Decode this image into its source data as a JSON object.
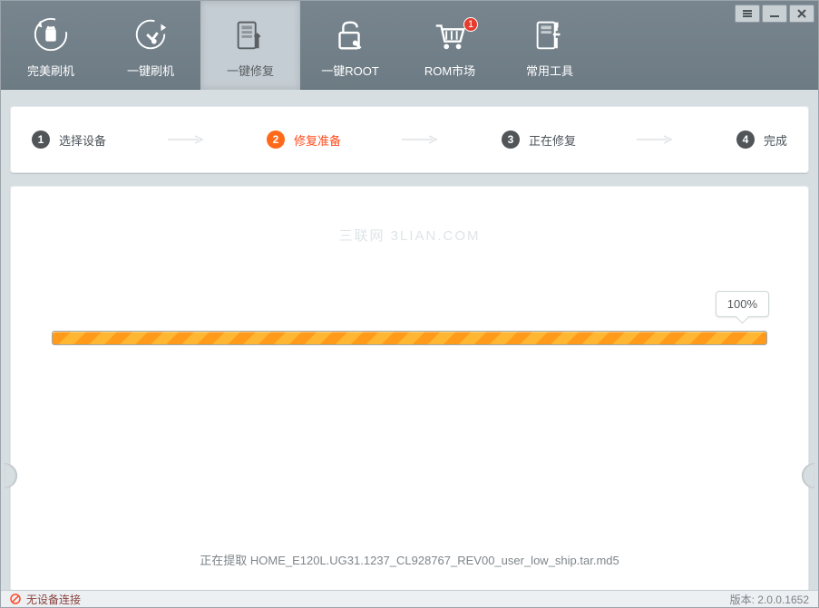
{
  "nav": {
    "items": [
      {
        "label": "完美刷机"
      },
      {
        "label": "一键刷机"
      },
      {
        "label": "一键修复"
      },
      {
        "label": "一键ROOT"
      },
      {
        "label": "ROM市场",
        "badge": "1"
      },
      {
        "label": "常用工具"
      }
    ]
  },
  "steps": {
    "items": [
      {
        "num": "1",
        "label": "选择设备"
      },
      {
        "num": "2",
        "label": "修复准备"
      },
      {
        "num": "3",
        "label": "正在修复"
      },
      {
        "num": "4",
        "label": "完成"
      }
    ],
    "active_index": 1
  },
  "watermark": "三联网 3LIAN.COM",
  "progress": {
    "percent_text": "100%",
    "percent": 100
  },
  "status": "正在提取 HOME_E120L.UG31.1237_CL928767_REV00_user_low_ship.tar.md5",
  "footer": {
    "device_status": "无设备连接",
    "version": "版本: 2.0.0.1652"
  }
}
